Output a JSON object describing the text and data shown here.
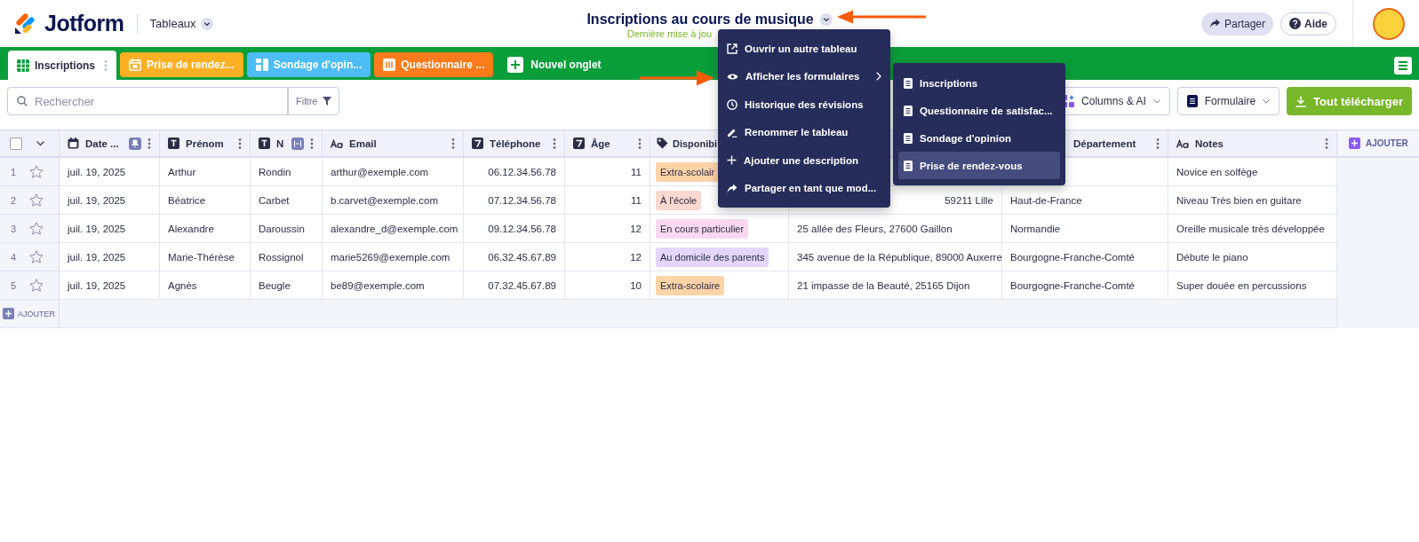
{
  "header": {
    "logo": "Jotform",
    "workspace": "Tableaux",
    "title": "Inscriptions au cours de musique",
    "subtitle": "Dernière mise à jou",
    "share": "Partager",
    "help": "Aide"
  },
  "tabs": [
    {
      "label": "Inscriptions",
      "selected": true,
      "kind": "table",
      "color": "#ffffff"
    },
    {
      "label": "Prise de rendez...",
      "selected": false,
      "kind": "appointment",
      "color": "#fdb023"
    },
    {
      "label": "Sondage d'opin...",
      "selected": false,
      "kind": "survey",
      "color": "#4dbdf5"
    },
    {
      "label": "Questionnaire ...",
      "selected": false,
      "kind": "report",
      "color": "#ff7b1c"
    }
  ],
  "new_tab": "Nouvel onglet",
  "toolbar": {
    "search_placeholder": "Rechercher",
    "filter": "Filtre",
    "columns_ai": "Columns & AI",
    "form": "Formulaire",
    "download": "Tout télécharger"
  },
  "table": {
    "select_all": {
      "checked": false
    },
    "columns": [
      {
        "label": "Date ...",
        "kind": "date"
      },
      {
        "label": "Prénom",
        "kind": "name"
      },
      {
        "label": "N",
        "kind": "name"
      },
      {
        "label": "Email",
        "kind": "email"
      },
      {
        "label": "Téléphone",
        "kind": "number"
      },
      {
        "label": "Âge",
        "kind": "number"
      },
      {
        "label": "Disponibi",
        "kind": "tag"
      },
      {
        "kind": "address"
      },
      {
        "label": "Département",
        "kind": "region"
      },
      {
        "label": "Notes",
        "kind": "longtext"
      }
    ],
    "rows": [
      {
        "number": "1",
        "starred": false,
        "cells": [
          "juil. 19, 2025",
          "Arthur",
          "Rondin",
          "arthur@exemple.com",
          "06.12.34.56.78",
          "11",
          {
            "text": "Extra-scolair",
            "color": "#fdd3a8"
          },
          null,
          null,
          "Novice en solfège"
        ]
      },
      {
        "number": "2",
        "starred": false,
        "cells": [
          "juil. 19, 2025",
          "Béatrice",
          "Carbet",
          "b.carvet@exemple.com",
          "07.12.34.56.78",
          "11",
          {
            "text": "À l'école",
            "color": "#fdd8d0"
          },
          {
            "text": "59211 Lille",
            "covered": true
          },
          "Haut-de-France",
          "Niveau Très bien en guitare"
        ]
      },
      {
        "number": "3",
        "starred": false,
        "cells": [
          "juil. 19, 2025",
          "Alexandre",
          "Daroussin",
          "alexandre_d@exemple.com",
          "09.12.34.56.78",
          "12",
          {
            "text": "En cours particulier",
            "color": "#fbd8f0"
          },
          "25 allée des Fleurs, 27600 Gaillon",
          "Normandie",
          "Oreille musicale très développée"
        ]
      },
      {
        "number": "4",
        "starred": false,
        "cells": [
          "juil. 19, 2025",
          "Marie-Thérèse",
          "Rossignol",
          "marie5269@exemple.com",
          "06.32.45.67.89",
          "12",
          {
            "text": "Au domicile des parents",
            "color": "#e4d6fb"
          },
          "345 avenue de la République, 89000 Auxerre",
          "Bourgogne-Franche-Comté",
          "Débute le piano"
        ]
      },
      {
        "number": "5",
        "starred": false,
        "cells": [
          "juil. 19, 2025",
          "Agnès",
          "Beugle",
          "be89@exemple.com",
          "07.32.45.67.89",
          "10",
          {
            "text": "Extra-scolaire",
            "color": "#fdd3a8"
          },
          "21 impasse de la Beauté, 25165 Dijon",
          "Bourgogne-Franche-Comté",
          "Super douée en percussions"
        ]
      }
    ],
    "add_row": "AJOUTER",
    "add_column": "AJOUTER"
  },
  "menu": {
    "items": [
      {
        "label": "Ouvrir un autre tableau",
        "kind": "open",
        "submenu": false
      },
      {
        "label": "Afficher les formulaires",
        "kind": "view",
        "submenu": true
      },
      {
        "label": "Historique des révisions",
        "kind": "history",
        "submenu": false
      },
      {
        "label": "Renommer le tableau",
        "kind": "rename",
        "submenu": false
      },
      {
        "label": "Ajouter une description",
        "kind": "add",
        "submenu": false
      },
      {
        "label": "Partager en tant que mod...",
        "kind": "share",
        "submenu": false
      }
    ]
  },
  "submenu": {
    "items": [
      {
        "label": "Inscriptions",
        "selected": false
      },
      {
        "label": "Questionnaire de satisfac...",
        "selected": false
      },
      {
        "label": "Sondage d'opinion",
        "selected": false
      },
      {
        "label": "Prise de rendez-vous",
        "selected": true
      }
    ]
  }
}
